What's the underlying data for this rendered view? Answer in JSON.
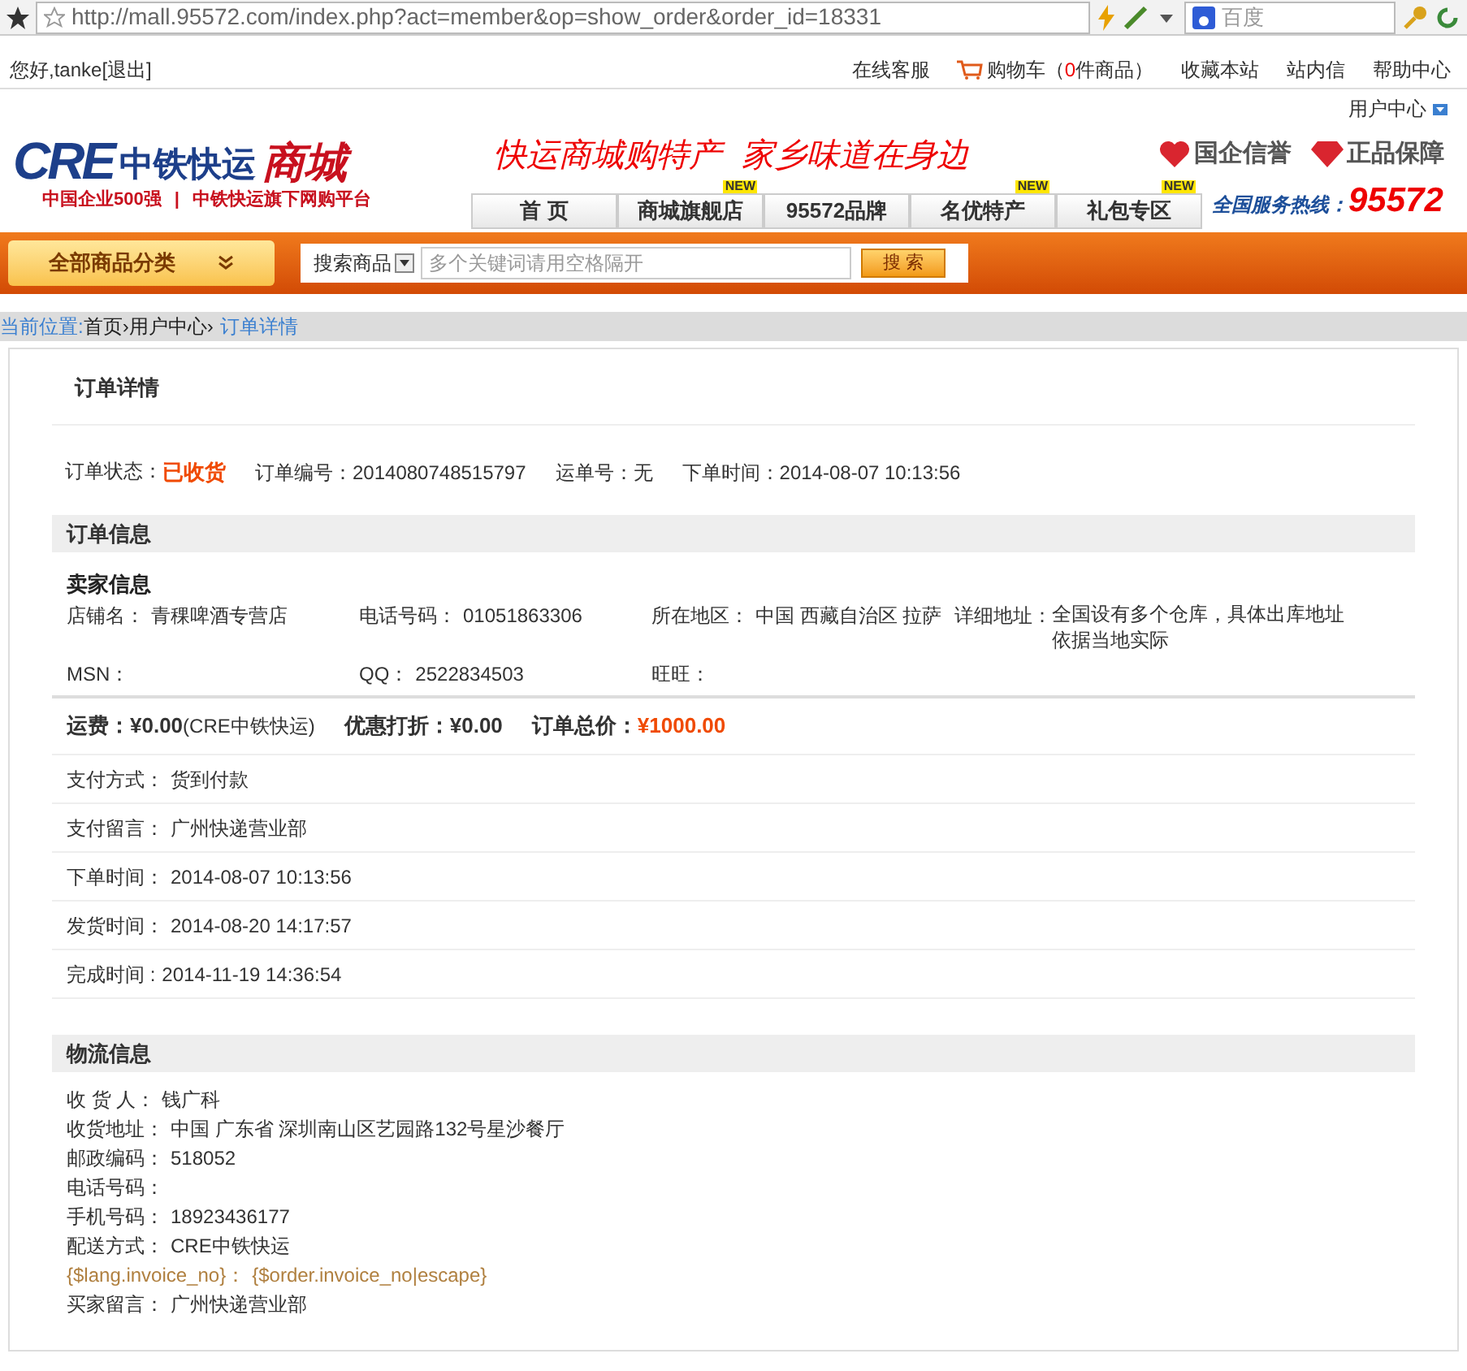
{
  "browser": {
    "url": "http://mall.95572.com/index.php?act=member&op=show_order&order_id=18331",
    "search_placeholder": "百度"
  },
  "topbar": {
    "greeting": "您好,tanke",
    "logout": "[退出]",
    "links": [
      {
        "kind": "link",
        "label": "在线客服"
      },
      {
        "kind": "cart",
        "label": "购物车（",
        "count": "0",
        "suffix": "件商品）"
      },
      {
        "kind": "link",
        "label": "收藏本站"
      },
      {
        "kind": "link",
        "label": "站内信"
      },
      {
        "kind": "link",
        "label": "帮助中心"
      }
    ]
  },
  "user_center": "用户中心",
  "logo": {
    "mark": "CRE",
    "name": "中铁快运",
    "mall": "商城",
    "tagline_left": "中国企业500强",
    "separator": "|",
    "tagline_right": "中铁快运旗下网购平台"
  },
  "slogan": "快运商城购特产  家乡味道在身边",
  "badges": [
    "国企信誉",
    "正品保障"
  ],
  "nav": [
    {
      "label": "首 页",
      "selected": false
    },
    {
      "label": "商城旗舰店",
      "badge": "NEW",
      "selected": false
    },
    {
      "label": "95572品牌",
      "selected": false
    },
    {
      "label": "名优特产",
      "badge": "NEW",
      "selected": false
    },
    {
      "label": "礼包专区",
      "badge": "NEW",
      "selected": false
    }
  ],
  "hotline": {
    "label": "全国服务热线：",
    "number": "95572"
  },
  "category_button": "全部商品分类",
  "search": {
    "scope": "搜索商品",
    "placeholder": "多个关键词请用空格隔开",
    "button": "搜 索"
  },
  "breadcrumb": {
    "label": "当前位置:",
    "items": [
      "首页›",
      "用户中心›"
    ],
    "current": "订单详情"
  },
  "order": {
    "title": "订单详情",
    "summary": [
      {
        "label": "订单状态：",
        "value": "已收货",
        "kind": "status"
      },
      {
        "label": "订单编号：",
        "value": "2014080748515797",
        "kind": "plain"
      },
      {
        "label": "运单号：",
        "value": "无",
        "kind": "plain"
      },
      {
        "label": "下单时间：",
        "value": "2014-08-07 10:13:56",
        "kind": "plain"
      }
    ],
    "info_title": "订单信息",
    "seller_title": "卖家信息",
    "seller": [
      {
        "label": "店铺名：",
        "value": "青稞啤酒专营店"
      },
      {
        "label": "电话号码：",
        "value": "01051863306"
      },
      {
        "label": "所在地区：",
        "value": "中国 西藏自治区 拉萨"
      },
      {
        "label": "详细地址：",
        "value": "全国设有多个仓库，具体出库地址依据当地实际"
      },
      {
        "label": "MSN："
      },
      {
        "label": "QQ：",
        "value": "2522834503"
      },
      {
        "label": "旺旺："
      }
    ],
    "totals": [
      {
        "label": "运费：",
        "value": "¥0.00",
        "note": "(CRE中铁快运)",
        "kind": "plain"
      },
      {
        "label": "优惠打折：",
        "value": "¥0.00",
        "kind": "plain"
      },
      {
        "label": "订单总价：",
        "value": "¥1000.00",
        "kind": "total"
      }
    ],
    "rows": [
      {
        "label": "支付方式：",
        "value": "货到付款"
      },
      {
        "label": "支付留言：",
        "value": "广州快递营业部"
      },
      {
        "label": "下单时间：",
        "value": "2014-08-07 10:13:56"
      },
      {
        "label": "发货时间：",
        "value": "2014-08-20 14:17:57"
      },
      {
        "label": "完成时间 :",
        "value": "2014-11-19 14:36:54"
      }
    ],
    "logistics_title": "物流信息",
    "logistics": [
      {
        "label": "收 货 人：",
        "value": "钱广科",
        "kind": "plain"
      },
      {
        "label": "收货地址：",
        "value": "中国 广东省 深圳南山区艺园路132号星沙餐厅",
        "kind": "plain"
      },
      {
        "label": "邮政编码：",
        "value": "518052",
        "kind": "plain"
      },
      {
        "label": "电话号码：",
        "kind": "plain"
      },
      {
        "label": "手机号码：",
        "value": "18923436177",
        "kind": "plain"
      },
      {
        "label": "配送方式：",
        "value": "CRE中铁快运",
        "kind": "plain"
      },
      {
        "label": "{$lang.invoice_no}：",
        "value": "{$order.invoice_no|escape}",
        "kind": "template"
      },
      {
        "label": "买家留言：",
        "value": "广州快递营业部",
        "kind": "plain"
      }
    ]
  }
}
